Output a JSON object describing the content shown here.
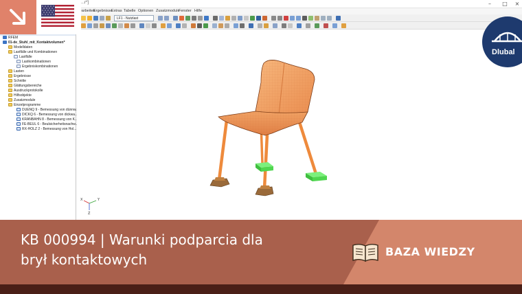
{
  "window": {
    "title": "...r*]"
  },
  "menu": {
    "items": [
      "Bearbeiten",
      "Ergebnisse",
      "Extras",
      "Tabelle",
      "Optionen",
      "Zusatzmodule",
      "Fenster",
      "Hilfe"
    ]
  },
  "toolbar": {
    "load_case": "LF1 - Nutzlast"
  },
  "navigator": {
    "items": [
      "RFEM",
      "01-de_Stuhl_mit_Kontaktvolumen*",
      "Modelldaten",
      "Lastfälle und Kombinationen",
      "Lastfälle",
      "Lastkombinationen",
      "Ergebniskombinationen",
      "Lasten",
      "Ergebnisse",
      "Schnitte",
      "Glättungsbereiche",
      "Ausdruckprotokolle",
      "Hilfsobjekte",
      "Zusatzmodule",
      "Einzelprogramme",
      "DUENQ 9 - Bemessung von dünnw...",
      "DICKQ 6 - Bemessung von dickwa...",
      "KRANBAHN 8 - Bemessung von K...",
      "FE-BEUL 6 - Beulsicherheitsnachw...",
      "RX-HOLZ 2 - Bemessung von Hol..."
    ]
  },
  "axes": {
    "x": "X",
    "y": "Y",
    "z": "Z"
  },
  "brand": {
    "name": "Dlubal"
  },
  "article": {
    "headline_line1": "KB 000994 | Warunki podparcia dla",
    "headline_line2": "brył kontaktowych",
    "category": "BAZA WIEDZY"
  },
  "colors": {
    "model_orange": "#f0a060",
    "support_green": "#4fd64f",
    "banner_dark": "#a9604c",
    "banner_light": "#d3866b",
    "strip": "#4a1f17",
    "dlubal_navy": "#1e3a6e",
    "arrow_tile": "#e0826a"
  },
  "icons": [
    "arrow-down-right-icon",
    "us-flag-icon",
    "dlubal-logo-icon",
    "book-icon"
  ]
}
